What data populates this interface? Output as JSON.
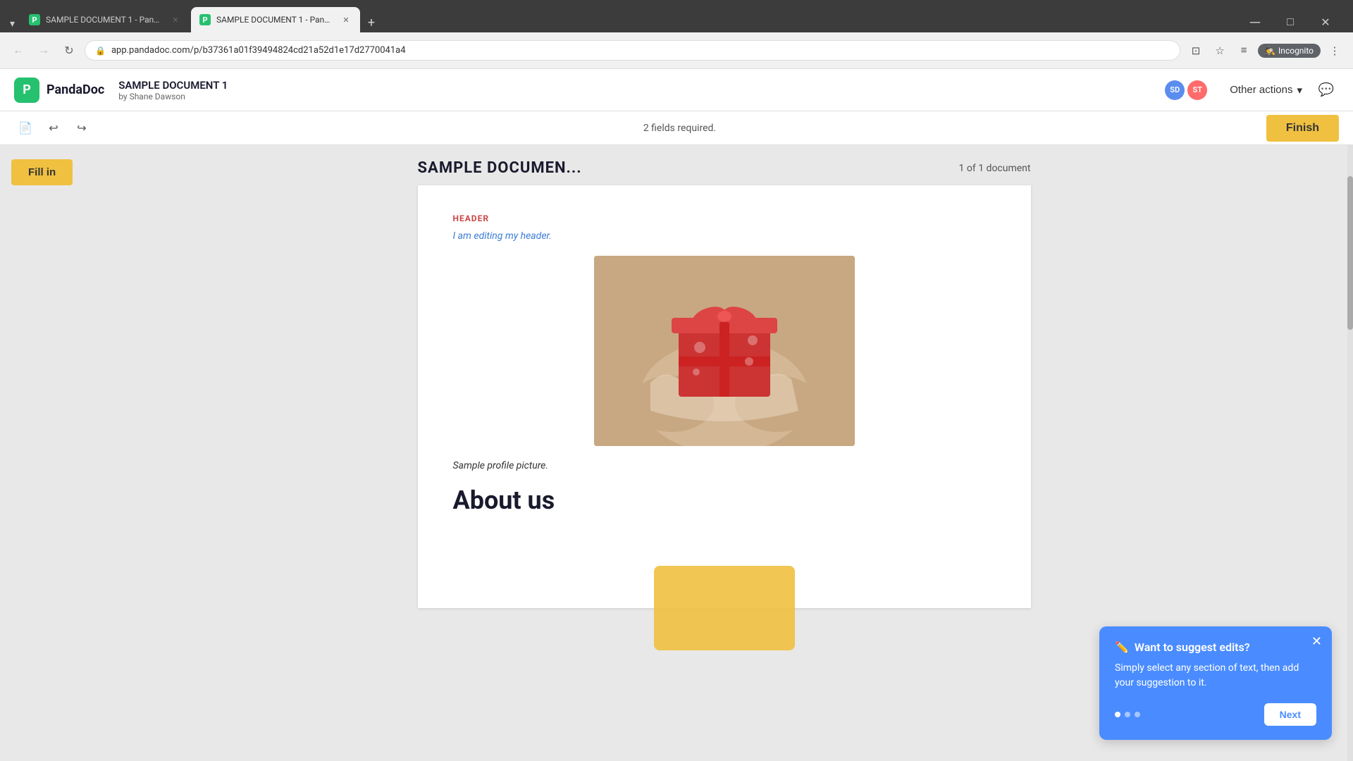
{
  "browser": {
    "tabs": [
      {
        "id": "tab1",
        "title": "SAMPLE DOCUMENT 1 - Panda...",
        "active": false
      },
      {
        "id": "tab2",
        "title": "SAMPLE DOCUMENT 1 - Panda...",
        "active": true
      }
    ],
    "new_tab_label": "+",
    "address": "app.pandadoc.com/p/b37361a01f39494824cd21a52d1e17d2770041a4",
    "incognito_label": "Incognito",
    "back_btn": "←",
    "forward_btn": "→",
    "refresh_btn": "↻"
  },
  "app": {
    "logo_letter": "P",
    "logo_name": "PandaDoc",
    "doc_title": "SAMPLE DOCUMENT 1",
    "doc_author": "by Shane Dawson",
    "avatar_sd": "SD",
    "avatar_st": "ST",
    "other_actions_label": "Other actions",
    "other_actions_chevron": "▾"
  },
  "toolbar": {
    "fields_required": "2 fields required.",
    "finish_label": "Finish"
  },
  "document": {
    "title": "SAMPLE DOCUMEN...",
    "count": "1 of 1 document",
    "fill_in_label": "Fill in",
    "page_header_label": "HEADER",
    "header_text": "I am editing my header.",
    "image_caption": "Sample profile picture.",
    "about_us_heading": "About us"
  },
  "popup": {
    "title": "Want to suggest edits?",
    "body": "Simply select any section of text, then add your suggestion to it.",
    "next_label": "Next",
    "dots": [
      {
        "active": true
      },
      {
        "active": false
      },
      {
        "active": false
      }
    ]
  }
}
